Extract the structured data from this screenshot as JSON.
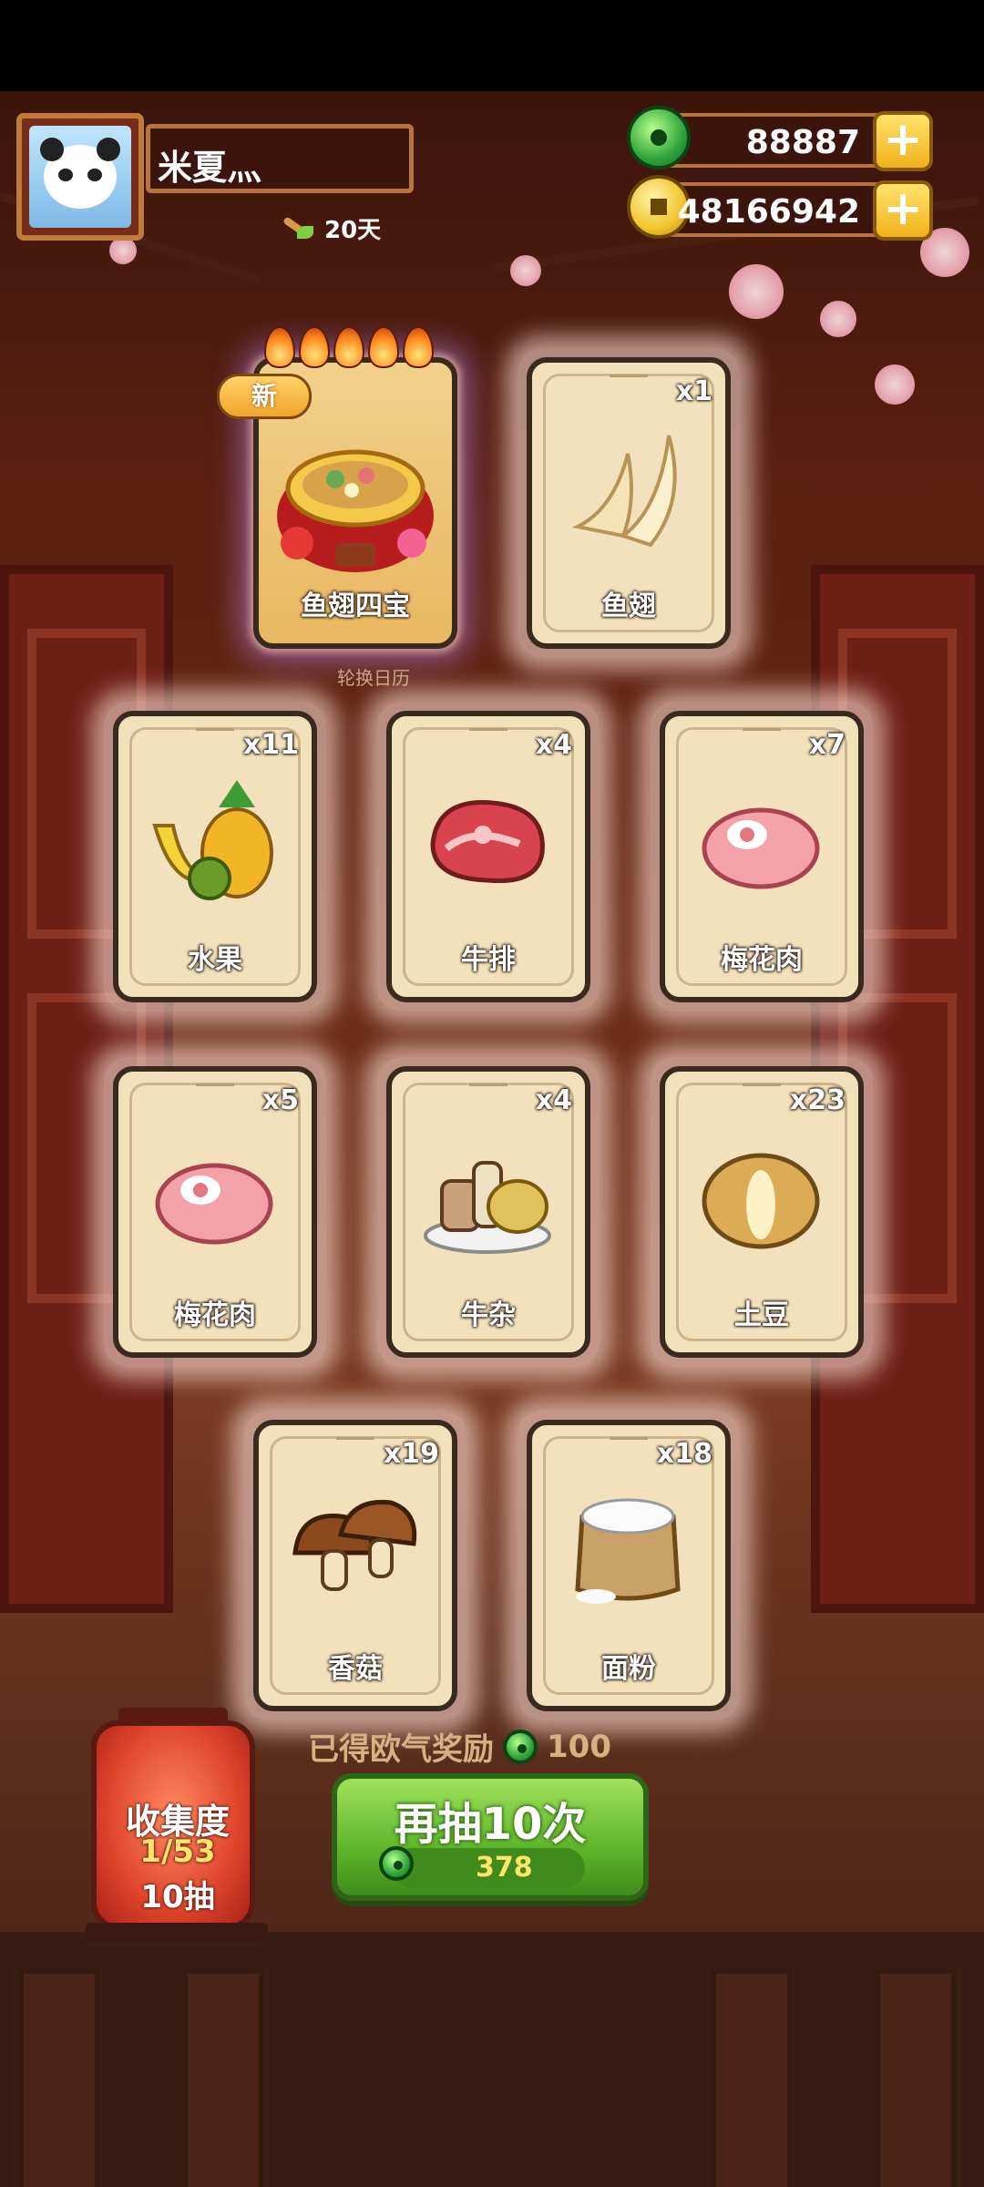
{
  "profile": {
    "name": "米夏灬",
    "days": "20天"
  },
  "currency": {
    "jade": "88887",
    "coins": "48166942"
  },
  "special_card": {
    "name": "鱼翅四宝",
    "badge": "新",
    "caption": "轮换日历"
  },
  "cards": [
    {
      "name": "鱼翅",
      "qty": "x1",
      "icon": "fin-icon"
    },
    {
      "name": "水果",
      "qty": "x11",
      "icon": "fruit-icon"
    },
    {
      "name": "牛排",
      "qty": "x4",
      "icon": "steak-icon"
    },
    {
      "name": "梅花肉",
      "qty": "x7",
      "icon": "pork-icon"
    },
    {
      "name": "梅花肉",
      "qty": "x5",
      "icon": "pork-icon"
    },
    {
      "name": "牛杂",
      "qty": "x4",
      "icon": "offal-icon"
    },
    {
      "name": "土豆",
      "qty": "x23",
      "icon": "potato-icon"
    },
    {
      "name": "香菇",
      "qty": "x19",
      "icon": "mushroom-icon"
    },
    {
      "name": "面粉",
      "qty": "x18",
      "icon": "flour-icon"
    }
  ],
  "collection": {
    "title": "收集度",
    "progress": "1/53",
    "draws": "10抽"
  },
  "reward": {
    "label": "已得欧气奖励",
    "value": "100"
  },
  "draw_button": {
    "label": "再抽10次",
    "cost": "378"
  }
}
